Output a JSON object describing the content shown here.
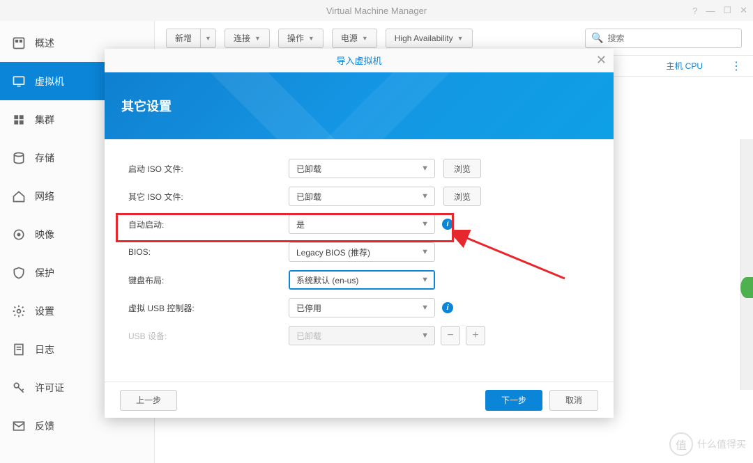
{
  "window": {
    "title": "Virtual Machine Manager"
  },
  "sidebar": {
    "items": [
      {
        "label": "概述"
      },
      {
        "label": "虚拟机"
      },
      {
        "label": "集群"
      },
      {
        "label": "存储"
      },
      {
        "label": "网络"
      },
      {
        "label": "映像"
      },
      {
        "label": "保护"
      },
      {
        "label": "设置"
      },
      {
        "label": "日志"
      },
      {
        "label": "许可证"
      },
      {
        "label": "反馈"
      }
    ],
    "active_index": 1
  },
  "toolbar": {
    "add": "新增",
    "connect": "连接",
    "action": "操作",
    "power": "电源",
    "ha": "High Availability",
    "search_placeholder": "搜索"
  },
  "table_header": {
    "col_cpu": "主机 CPU"
  },
  "modal": {
    "title": "导入虚拟机",
    "banner_title": "其它设置",
    "fields": {
      "boot_iso_label": "启动 ISO 文件:",
      "boot_iso_value": "已卸载",
      "other_iso_label": "其它 ISO 文件:",
      "other_iso_value": "已卸载",
      "browse": "浏览",
      "autostart_label": "自动启动:",
      "autostart_value": "是",
      "bios_label": "BIOS:",
      "bios_value": "Legacy BIOS (推荐)",
      "keyboard_label": "键盘布局:",
      "keyboard_value": "系统默认 (en-us)",
      "usb_ctrl_label": "虚拟 USB 控制器:",
      "usb_ctrl_value": "已停用",
      "usb_dev_label": "USB 设备:",
      "usb_dev_value": "已卸载"
    },
    "footer": {
      "prev": "上一步",
      "next": "下一步",
      "cancel": "取消"
    }
  },
  "watermark": {
    "text": "什么值得买",
    "badge": "值"
  }
}
